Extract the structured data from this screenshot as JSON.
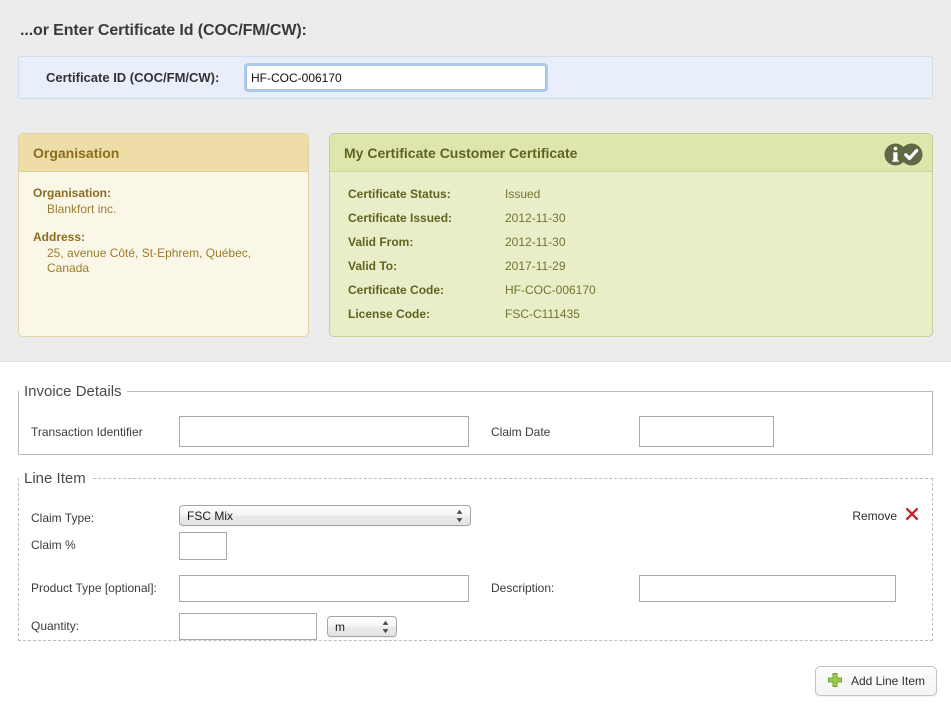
{
  "page": {
    "heading": "...or Enter Certificate Id (COC/FM/CW):"
  },
  "cert_id_bar": {
    "label": "Certificate ID (COC/FM/CW):",
    "value": "HF-COC-006170",
    "placeholder": ""
  },
  "organisation_panel": {
    "title": "Organisation",
    "fields": [
      {
        "label": "Organisation:",
        "value": "Blankfort inc."
      },
      {
        "label": "Address:",
        "value": "25, avenue Côté, St-Ephrem, Québec, Canada"
      }
    ]
  },
  "certificate_panel": {
    "title": "My Certificate Customer Certificate",
    "icons": [
      "info-icon",
      "check-icon"
    ],
    "rows": [
      {
        "label": "Certificate Status:",
        "value": "Issued"
      },
      {
        "label": "Certificate Issued:",
        "value": "2012-11-30"
      },
      {
        "label": "Valid From:",
        "value": "2012-11-30"
      },
      {
        "label": "Valid To:",
        "value": "2017-11-29"
      },
      {
        "label": "Certificate Code:",
        "value": "HF-COC-006170"
      },
      {
        "label": "License Code:",
        "value": "FSC-C111435"
      }
    ]
  },
  "invoice_details": {
    "legend": "Invoice Details",
    "transaction_identifier": {
      "label": "Transaction Identifier",
      "value": "",
      "placeholder": ""
    },
    "claim_date": {
      "label": "Claim Date",
      "value": "",
      "placeholder": ""
    }
  },
  "line_item": {
    "legend": "Line Item",
    "remove_label": "Remove",
    "claim_type": {
      "label": "Claim Type:",
      "value": "FSC Mix"
    },
    "claim_percent": {
      "label": "Claim %",
      "value": "",
      "placeholder": ""
    },
    "product_type": {
      "label": "Product Type [optional]:",
      "value": "",
      "placeholder": ""
    },
    "description": {
      "label": "Description:",
      "value": "",
      "placeholder": ""
    },
    "quantity": {
      "label": "Quantity:",
      "value": "",
      "placeholder": ""
    },
    "quantity_unit": {
      "value": "m"
    }
  },
  "footer": {
    "add_line_item_label": "Add Line Item"
  },
  "colors": {
    "page_top_bg": "#ececec",
    "cert_id_bar_bg": "#e8eefa",
    "org_header_bg": "#eedda6",
    "org_body_bg": "#fbf7e8",
    "org_text": "#8a6d1e",
    "cert_header_bg": "#dfe6ad",
    "cert_body_bg": "#eaeec8",
    "cert_text": "#5d6420",
    "remove_x": "#cc2027",
    "add_plus": "#8dc63f"
  }
}
